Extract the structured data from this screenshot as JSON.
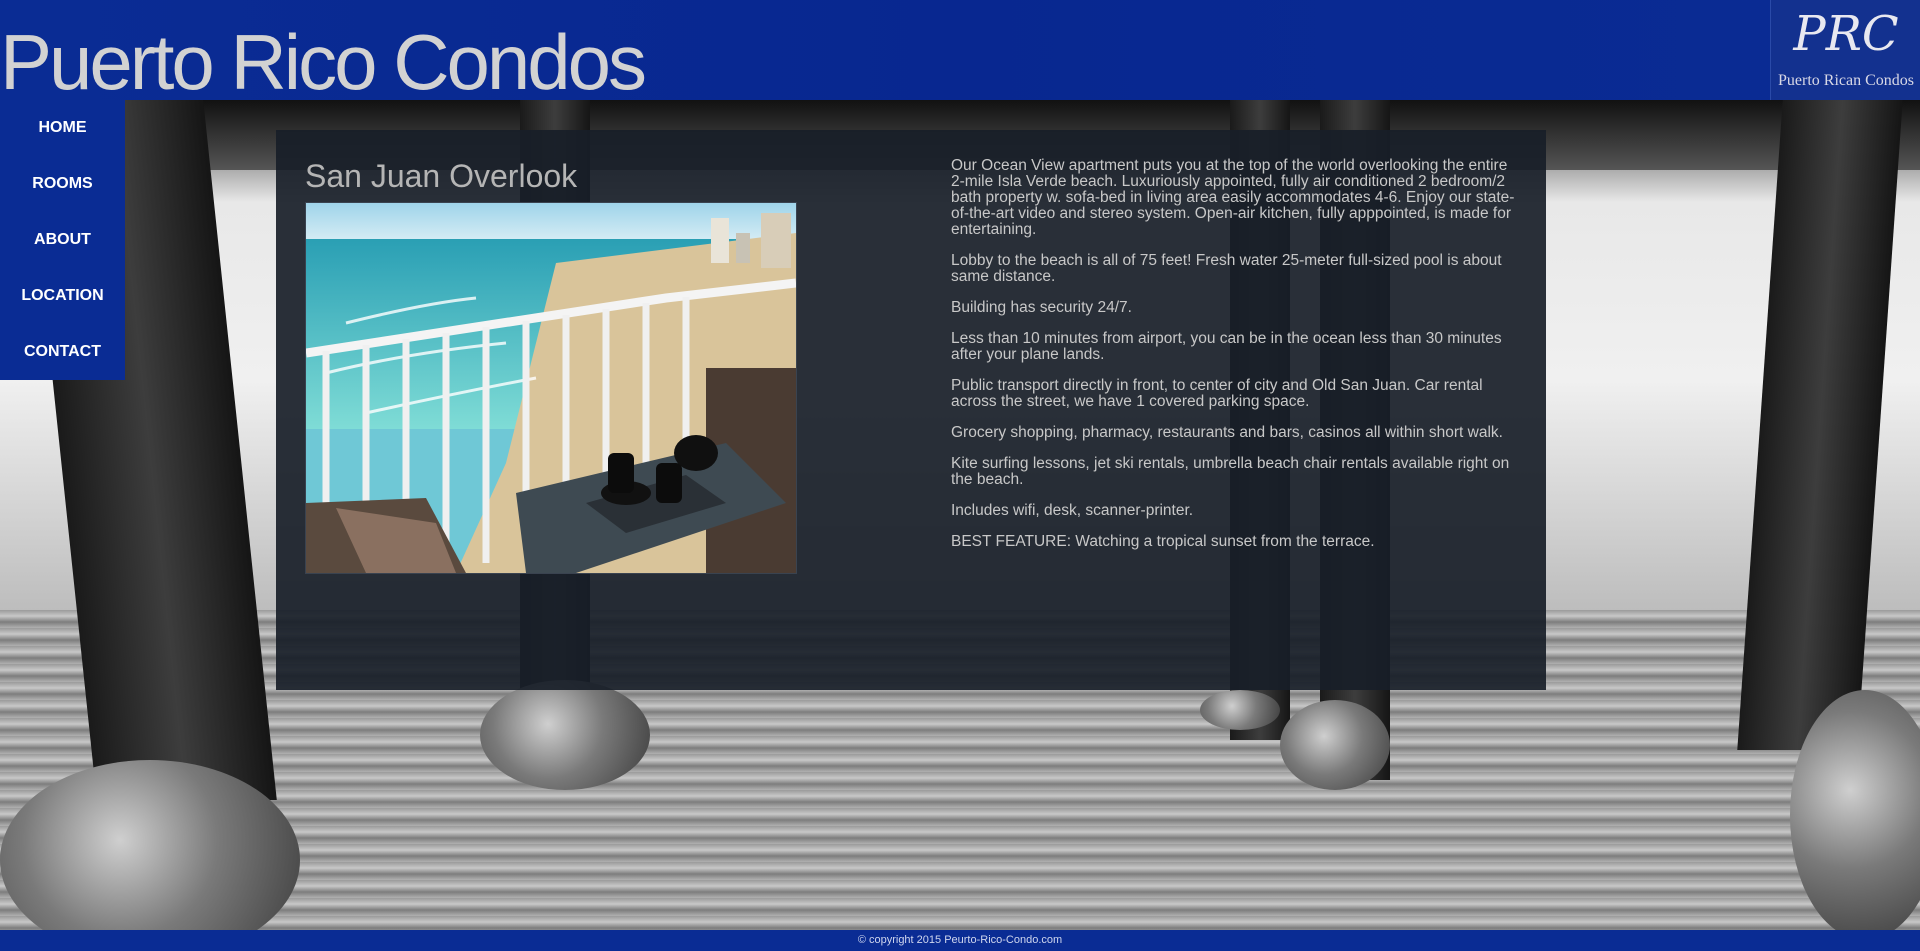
{
  "header": {
    "site_title": "Puerto Rico Condos",
    "logo_mark": "PRC",
    "logo_subtitle": "Puerto Rican Condos"
  },
  "nav": {
    "items": [
      {
        "label": "HOME"
      },
      {
        "label": "ROOMS"
      },
      {
        "label": "ABOUT"
      },
      {
        "label": "LOCATION"
      },
      {
        "label": "CONTACT"
      }
    ]
  },
  "main": {
    "title": "San Juan Overlook",
    "paragraphs": [
      "Our Ocean View apartment puts you at the top of the world overlooking the entire 2-mile Isla Verde beach. Luxuriously appointed, fully air conditioned 2 bedroom/2 bath property w. sofa-bed in living area easily accommodates 4-6. Enjoy our state-of-the-art video and stereo system. Open-air kitchen, fully apppointed, is made for entertaining.",
      "Lobby to the beach is all of 75 feet! Fresh water 25-meter full-sized pool is about same distance.",
      "Building has security 24/7.",
      "Less than 10 minutes from airport, you can be in the ocean less than 30 minutes after your plane lands.",
      "Public transport directly in front, to center of city and Old San Juan. Car rental across the street, we have 1 covered parking space.",
      "Grocery shopping, pharmacy, restaurants and bars, casinos all within short walk.",
      "Kite surfing lessons, jet ski rentals, umbrella beach chair rentals available right on the beach.",
      "Includes wifi, desk, scanner-printer.",
      "BEST FEATURE: Watching a tropical sunset from the terrace."
    ]
  },
  "footer": {
    "copyright": "© copyright 2015 Peurto-Rico-Condo.com"
  },
  "colors": {
    "header_blue": "#0a2c94",
    "panel_bg": "#181e28",
    "title_gray": "#d2d2d2",
    "body_text": "#c8c8c8"
  }
}
